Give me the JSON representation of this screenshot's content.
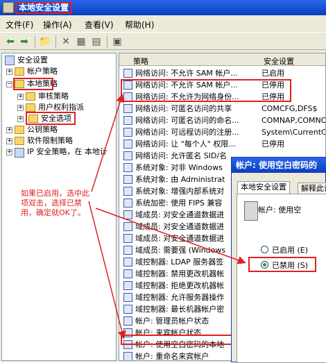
{
  "window": {
    "title": "本地安全设置"
  },
  "menu": {
    "items": [
      "文件(F)",
      "操作(A)",
      "查看(V)",
      "帮助(H)"
    ]
  },
  "tree": {
    "root": "安全设置",
    "account_policy": "帐户策略",
    "local_policy": "本地策略",
    "audit_policy": "审核策略",
    "user_rights": "用户权利指派",
    "security_options": "安全选项",
    "public_key": "公钥策略",
    "software_restriction": "软件限制策略",
    "ip_security": "IP 安全策略，在 本地计"
  },
  "list": {
    "col_policy": "策略",
    "col_setting": "安全设置",
    "rows": [
      {
        "name": "网络访问: 不允许 SAM 帐户...",
        "value": "已启用"
      },
      {
        "name": "网络访问: 不允许 SAM 帐户...",
        "value": "已停用"
      },
      {
        "name": "网络访问: 不允许为网络身份...",
        "value": "已停用"
      },
      {
        "name": "网络访问: 可匿名访问的共享",
        "value": "COMCFG,DFS$"
      },
      {
        "name": "网络访问: 可匿名访问的命名...",
        "value": "COMNAP,COMNODE,..."
      },
      {
        "name": "网络访问: 可远程访问的注册...",
        "value": "System\\CurrentC..."
      },
      {
        "name": "网络访问: 让 \"每个人\" 权限...",
        "value": "已停用"
      },
      {
        "name": "网络访问: 允许匿名 SID/名",
        "value": ""
      },
      {
        "name": "系统对象: 对非 Windows",
        "value": ""
      },
      {
        "name": "系统对象: 由 Administrat",
        "value": ""
      },
      {
        "name": "系统对象: 增强内部系统对",
        "value": ""
      },
      {
        "name": "系统加密: 使用 FIPS 兼容",
        "value": ""
      },
      {
        "name": "域成员: 对安全通道数据进",
        "value": ""
      },
      {
        "name": "域成员: 对安全通道数据进",
        "value": ""
      },
      {
        "name": "域成员: 对安全通道数据进",
        "value": ""
      },
      {
        "name": "域成员: 需要强 (Windows",
        "value": ""
      },
      {
        "name": "域控制器: LDAP 服务器签",
        "value": ""
      },
      {
        "name": "域控制器: 禁用更改机器帐",
        "value": ""
      },
      {
        "name": "域控制器: 拒绝更改机器帐",
        "value": ""
      },
      {
        "name": "域控制器: 允许服务器操作",
        "value": ""
      },
      {
        "name": "域控制器: 最长机器帐户密",
        "value": ""
      },
      {
        "name": "帐户: 管理员帐户状态",
        "value": ""
      },
      {
        "name": "帐户: 来宾帐户状态",
        "value": ""
      },
      {
        "name": "帐户: 使用空白密码的本地",
        "value": ""
      },
      {
        "name": "帐户: 重命名来宾帐户",
        "value": ""
      }
    ]
  },
  "dialog": {
    "title": "帐户: 使用空白密码的",
    "tab_local": "本地安全设置",
    "tab_explain": "解释此设",
    "account_label": "帐户: 使用空",
    "option_enabled": "已启用 (E)",
    "option_disabled": "已禁用 (S)",
    "selected": "disabled"
  },
  "annotation": {
    "text": "如果已启用，选中此项双击，选择已禁用，确定就OK了。"
  },
  "colors": {
    "highlight": "#e02020",
    "titlebar": "#0a3ec0"
  }
}
